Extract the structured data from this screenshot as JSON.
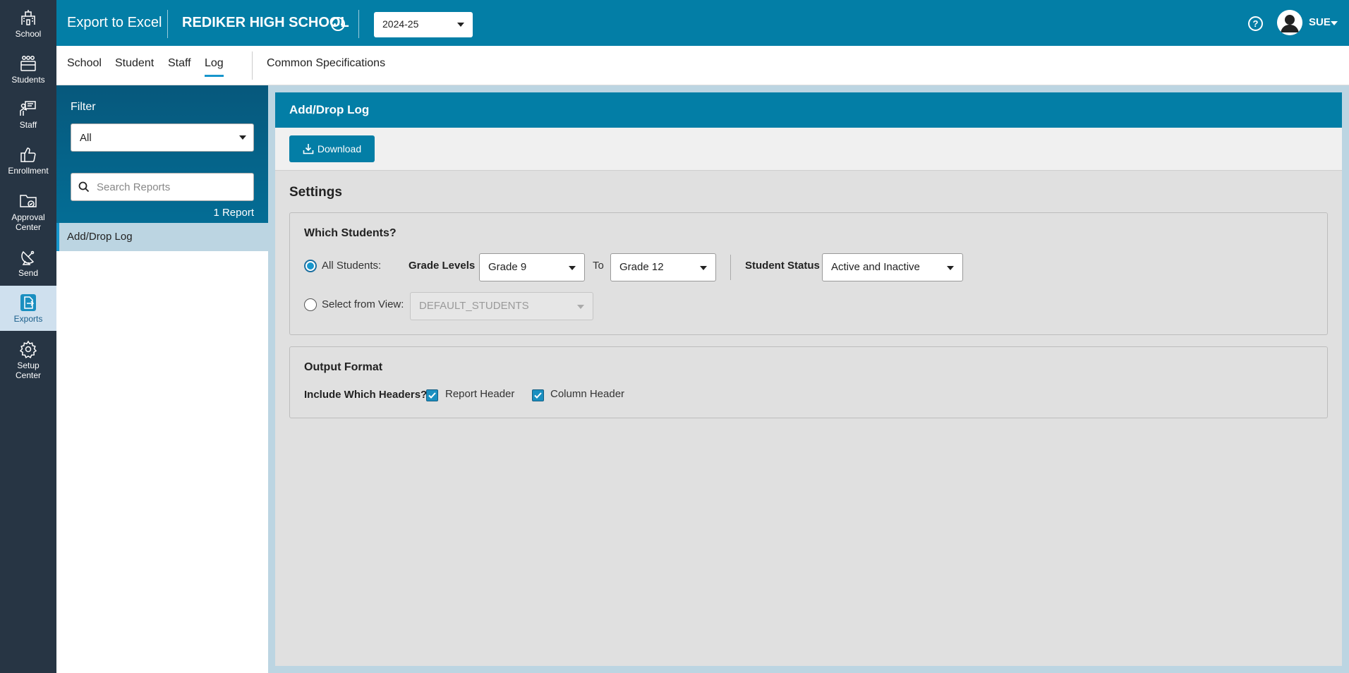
{
  "nav": {
    "items": [
      {
        "label": "School",
        "icon": "school-icon"
      },
      {
        "label": "Students",
        "icon": "students-icon"
      },
      {
        "label": "Staff",
        "icon": "staff-icon"
      },
      {
        "label": "Enrollment",
        "icon": "thumbs-up-icon"
      },
      {
        "label": "Approval Center",
        "icon": "folder-check-icon"
      },
      {
        "label": "Send",
        "icon": "satellite-dish-icon"
      },
      {
        "label": "Exports",
        "icon": "export-file-icon"
      },
      {
        "label": "Setup Center",
        "icon": "gear-icon"
      }
    ],
    "active": "Exports"
  },
  "header": {
    "app_title": "Export to Excel",
    "school_name": "REDIKER HIGH SCHOOL",
    "school_year": "2024-25",
    "user_name": "SUE"
  },
  "tabs": {
    "items": [
      "School",
      "Student",
      "Staff",
      "Log"
    ],
    "active": "Log",
    "extra": "Common Specifications"
  },
  "sidebar": {
    "filter_label": "Filter",
    "filter_value": "All",
    "search_placeholder": "Search Reports",
    "report_count": "1 Report",
    "reports": [
      "Add/Drop Log"
    ]
  },
  "main": {
    "title": "Add/Drop Log",
    "download_label": "Download",
    "settings_title": "Settings",
    "which_students": {
      "title": "Which Students?",
      "all_students_label": "All Students:",
      "all_students_selected": true,
      "grade_levels_label": "Grade Levels",
      "grade_from": "Grade 9",
      "to_label": "To",
      "grade_to": "Grade 12",
      "status_label": "Student Status",
      "status_value": "Active and Inactive",
      "select_view_label": "Select from View:",
      "view_value": "DEFAULT_STUDENTS"
    },
    "output_format": {
      "title": "Output Format",
      "headers_label": "Include Which Headers?",
      "report_header_label": "Report Header",
      "report_header_checked": true,
      "column_header_label": "Column Header",
      "column_header_checked": true
    }
  },
  "colors": {
    "brand_blue": "#037ea6",
    "rail_dark": "#273544",
    "accent": "#1796cc"
  }
}
